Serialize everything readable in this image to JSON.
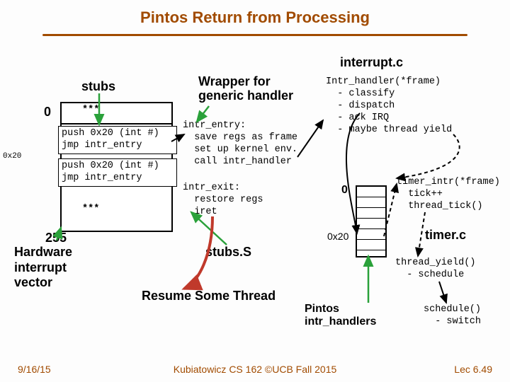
{
  "title": "Pintos Return from Processing",
  "footer": {
    "left": "9/16/15",
    "mid": "Kubiatowicz CS 162 ©UCB Fall 2015",
    "right": "Lec 6.49"
  },
  "interrupt_c": "interrupt.c",
  "stubs_heading": "stubs",
  "stars": "***",
  "zero": "0",
  "ox20_left": "0x20",
  "stub_code": "push 0x20 (int #)\njmp intr_entry",
  "two55": "255",
  "hw_vector": "Hardware\ninterrupt\nvector",
  "wrapper": "Wrapper for\ngeneric handler",
  "intr_entry": "intr_entry:\n  save regs as frame\n  set up kernel env.\n  call intr_handler",
  "intr_exit": "intr_exit:\n  restore regs\n  iret",
  "stubs_s": "stubs.S",
  "resume": "Resume Some Thread",
  "intr_handler": "Intr_handler(*frame)\n  - classify\n  - dispatch\n  - ack IRQ\n  - maybe thread yield",
  "timer_intr": "timer_intr(*frame)\n  tick++\n  thread_tick()",
  "timer_c": "timer.c",
  "thread_yield": "thread_yield()\n  - schedule",
  "schedule": "schedule()\n  - switch",
  "pintos_handlers": "Pintos\nintr_handlers",
  "zero_right": "0",
  "ox20_right": "0x20"
}
